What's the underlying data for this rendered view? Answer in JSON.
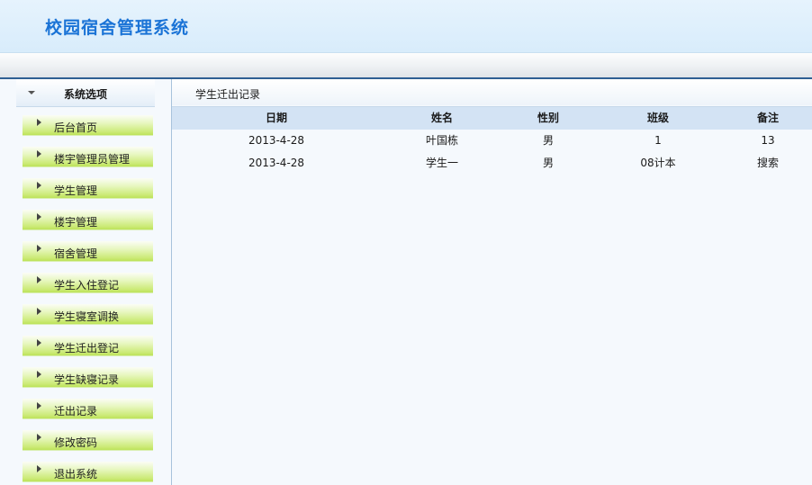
{
  "app": {
    "title": "校园宿舍管理系统"
  },
  "sidebar": {
    "header_label": "系统选项",
    "items": [
      {
        "label": "后台首页"
      },
      {
        "label": "楼宇管理员管理"
      },
      {
        "label": "学生管理"
      },
      {
        "label": "楼宇管理"
      },
      {
        "label": "宿舍管理"
      },
      {
        "label": "学生入住登记"
      },
      {
        "label": "学生寝室调换"
      },
      {
        "label": "学生迁出登记"
      },
      {
        "label": "学生缺寝记录"
      },
      {
        "label": "迁出记录"
      },
      {
        "label": "修改密码"
      },
      {
        "label": "退出系统"
      }
    ]
  },
  "main": {
    "title": "学生迁出记录",
    "columns": [
      "日期",
      "姓名",
      "性别",
      "班级",
      "备注"
    ],
    "rows": [
      [
        "2013-4-28",
        "叶国栋",
        "男",
        "1",
        "13"
      ],
      [
        "2013-4-28",
        "学生一",
        "男",
        "08计本",
        "搜索"
      ]
    ]
  },
  "colors": {
    "brand": "#1a73d6",
    "menu_green": "#cbea76",
    "header_bg": "#e6f3fd",
    "table_header_bg": "#d3e3f4",
    "divider": "#2f5f93"
  },
  "icons": {
    "sidebar_header": "caret-down-icon",
    "menu_item": "caret-right-icon"
  }
}
